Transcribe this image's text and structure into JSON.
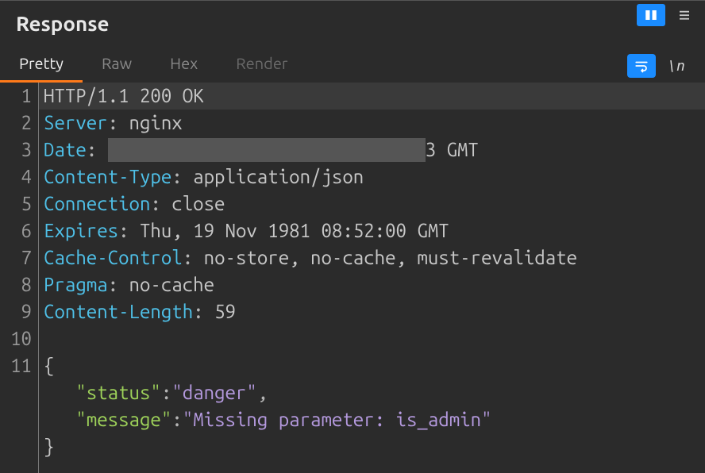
{
  "title": "Response",
  "tabs": {
    "pretty": "Pretty",
    "raw": "Raw",
    "hex": "Hex",
    "render": "Render",
    "active": "pretty"
  },
  "tools": {
    "slash_label": "\\n"
  },
  "response_lines": [
    {
      "n": 1,
      "kind": "status",
      "text": "HTTP/1.1 200 OK"
    },
    {
      "n": 2,
      "kind": "header",
      "key": "Server",
      "value": "nginx"
    },
    {
      "n": 3,
      "kind": "header-redacted",
      "key": "Date",
      "prefix": " ",
      "visible_suffix_char": "3",
      "suffix": " GMT"
    },
    {
      "n": 4,
      "kind": "header",
      "key": "Content-Type",
      "value": "application/json"
    },
    {
      "n": 5,
      "kind": "header",
      "key": "Connection",
      "value": "close"
    },
    {
      "n": 6,
      "kind": "header",
      "key": "Expires",
      "value": "Thu, 19 Nov 1981 08:52:00 GMT"
    },
    {
      "n": 7,
      "kind": "header",
      "key": "Cache-Control",
      "value": "no-store, no-cache, must-revalidate"
    },
    {
      "n": 8,
      "kind": "header",
      "key": "Pragma",
      "value": "no-cache"
    },
    {
      "n": 9,
      "kind": "header",
      "key": "Content-Length",
      "value": "59"
    },
    {
      "n": 10,
      "kind": "blank"
    },
    {
      "n": 11,
      "kind": "brace-open",
      "text": "{"
    }
  ],
  "json_body": {
    "indent": "   ",
    "pairs": [
      {
        "key": "status",
        "value": "danger",
        "comma": true
      },
      {
        "key": "message",
        "value": "Missing parameter: is_admin",
        "comma": false
      }
    ],
    "close": "}"
  }
}
